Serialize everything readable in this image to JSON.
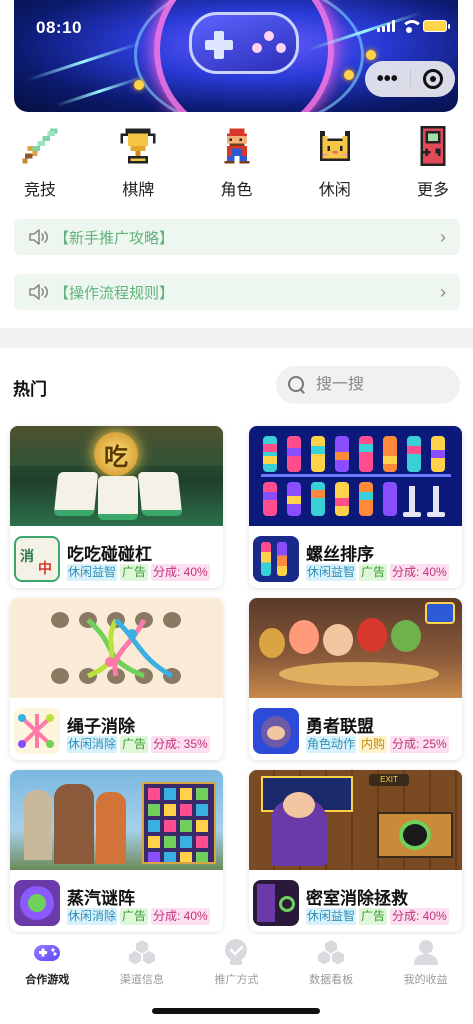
{
  "status": {
    "time": "08:10"
  },
  "categories": [
    {
      "label": "竞技",
      "icon": "pixel-sword-icon"
    },
    {
      "label": "棋牌",
      "icon": "pixel-trophy-icon"
    },
    {
      "label": "角色",
      "icon": "pixel-character-icon"
    },
    {
      "label": "休闲",
      "icon": "pixel-cat-icon"
    },
    {
      "label": "更多",
      "icon": "pixel-gameboy-icon"
    }
  ],
  "notices": [
    {
      "text": "【新手推广攻略】"
    },
    {
      "text": "【操作流程规则】"
    }
  ],
  "hot": {
    "title": "热门",
    "search_placeholder": "搜一搜"
  },
  "games": [
    {
      "name": "吃吃碰碰杠",
      "genre": "休闲益智",
      "monetization": "广告",
      "share": "分成: 40%"
    },
    {
      "name": "螺丝排序",
      "genre": "休闲益智",
      "monetization": "广告",
      "share": "分成: 40%"
    },
    {
      "name": "绳子消除",
      "genre": "休闲消除",
      "monetization": "广告",
      "share": "分成: 35%"
    },
    {
      "name": "勇者联盟",
      "genre": "角色动作",
      "monetization": "内购",
      "share": "分成: 25%"
    },
    {
      "name": "蒸汽谜阵",
      "genre": "休闲消除",
      "monetization": "广告",
      "share": "分成: 40%"
    },
    {
      "name": "密室消除拯救",
      "genre": "休闲益智",
      "monetization": "广告",
      "share": "分成: 40%"
    }
  ],
  "tabs": [
    {
      "label": "合作游戏",
      "active": true
    },
    {
      "label": "渠道信息",
      "active": false
    },
    {
      "label": "推广方式",
      "active": false
    },
    {
      "label": "数据看板",
      "active": false
    },
    {
      "label": "我的收益",
      "active": false
    }
  ],
  "colors": {
    "accent": "#6b5cff",
    "notice_text": "#62b27c",
    "notice_bg": "#eef7ef"
  }
}
